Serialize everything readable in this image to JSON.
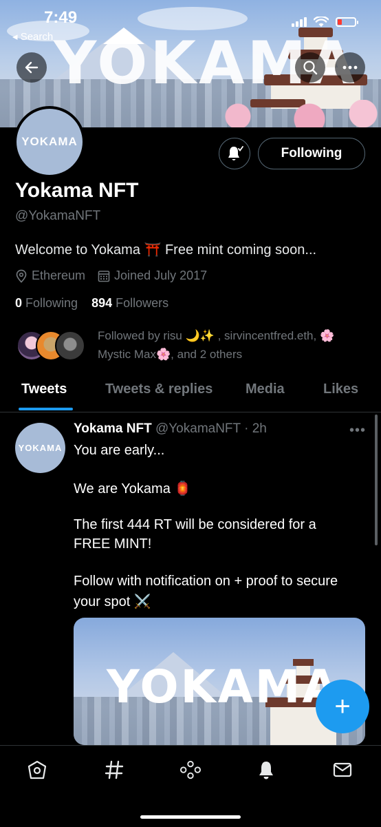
{
  "status": {
    "time": "7:49",
    "back_label": "◂ Search"
  },
  "banner": {
    "text": "YOKAMA"
  },
  "profile": {
    "avatar_text": "YOKAMA",
    "name": "Yokama NFT",
    "handle": "@YokamaNFT",
    "bio": "Welcome to Yokama ⛩️ Free mint coming soon...",
    "location": "Ethereum",
    "joined": "Joined July 2017",
    "following_count": "0",
    "following_label": "Following",
    "followers_count": "894",
    "followers_label": "Followers",
    "follow_button_label": "Following",
    "followed_by_line1": "Followed by risu 🌙✨ , sirvincentfred.eth, 🌸",
    "followed_by_line2": "Mystic Max🌸, and 2 others"
  },
  "tabs": [
    {
      "label": "Tweets",
      "active": true
    },
    {
      "label": "Tweets & replies",
      "active": false
    },
    {
      "label": "Media",
      "active": false
    },
    {
      "label": "Likes",
      "active": false
    }
  ],
  "tweet": {
    "author": "Yokama NFT",
    "handle_time": "@YokamaNFT · 2h",
    "more": "•••",
    "lines": [
      "You are early...",
      "We are Yokama 🏮",
      "The first 444 RT will be considered for a",
      "FREE MINT!",
      "Follow with notification on + proof to secure",
      "your spot ⚔️"
    ],
    "media_text": "YOKAMA"
  },
  "fab_label": "+",
  "colors": {
    "accent": "#1d9bf0",
    "background": "#000000",
    "muted": "#71767b",
    "avatar_bg": "#a7bbd7"
  },
  "nav": [
    "home-icon",
    "explore-icon",
    "spaces-icon",
    "notifications-icon",
    "messages-icon"
  ]
}
